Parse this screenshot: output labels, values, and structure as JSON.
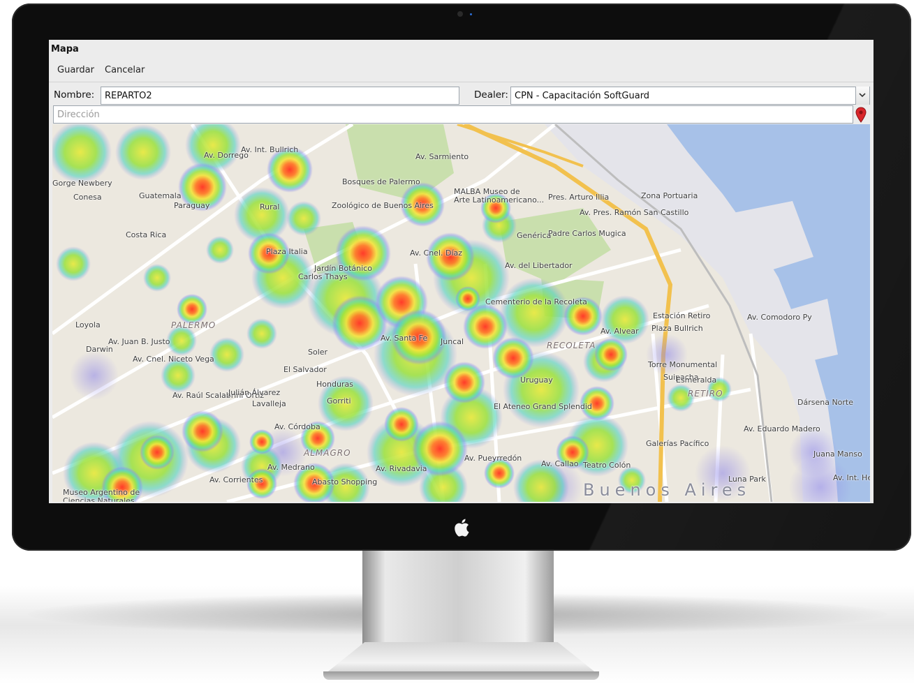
{
  "window": {
    "title": "Mapa"
  },
  "menu": {
    "guardar": "Guardar",
    "cancelar": "Cancelar"
  },
  "form": {
    "nombre_label": "Nombre:",
    "nombre_value": "REPARTO2",
    "dealer_label": "Dealer:",
    "dealer_value": "CPN - Capacitación SoftGuard",
    "direccion_placeholder": "Dirección"
  },
  "icons": {
    "dropdown": "chevron-down-icon",
    "location": "map-pin-icon",
    "brand": "apple-logo"
  },
  "colors": {
    "pin": "#d9262b",
    "water": "#a7c1e8",
    "park": "#c9dfad",
    "heat_hot": "#ff3b2a",
    "heat_mid": "#b9ea3c",
    "heat_low": "#9c8fe6"
  },
  "map": {
    "labels": [
      "Av. Dorrego",
      "Av. Int. Bullrich",
      "Bosques de Palermo",
      "MALBA Museo de",
      "Arte Latinoamericano...",
      "Av. Pres. Ramón San Castillo",
      "Pres. Arturo Illia",
      "Zona Portuaria",
      "Padre Carlos Mugica",
      "Genérica",
      "Av. del Libertador",
      "Cementerio de la Recoleta",
      "Estación Retiro",
      "Plaza Bullrich",
      "Av. Comodoro Py",
      "Torre Monumental",
      "Dársena Norte",
      "RETIRO",
      "RECOLETA",
      "PALERMO",
      "Galerías Pacífico",
      "Teatro Colón",
      "Luna Park",
      "Av. Eduardo Madero",
      "Av. Córdoba",
      "ALMAGRO",
      "Abasto Shopping",
      "Av. Corrientes",
      "Museo Argentino de",
      "Ciencias Naturales",
      "Buenos Aires",
      "Av. Raúl Scalabrini Ortiz",
      "El Salvador",
      "Honduras",
      "Gorriti",
      "Soler",
      "Juncal",
      "Av. Santa Fe",
      "Plaza Italia",
      "Jardín Botánico",
      "Carlos Thays",
      "Costa Rica",
      "Guatemala",
      "Paraguay",
      "Loyola",
      "Darwin",
      "Av. Juan B. Justo",
      "Av. Cnel. Niceto Vega",
      "Lavalleja",
      "Julián Álvarez",
      "Av. Medrano",
      "Av. Rivadavia",
      "Juana Manso",
      "Av. Int. Hernández",
      "Gorge Newbery",
      "Conesa",
      "Suipacha",
      "Esmeralda",
      "Av. Alvear",
      "Rural",
      "Zoológico de Buenos Aires",
      "Av. Pueyrredón",
      "Av. Cnel. Díaz",
      "Av. Callao",
      "El Ateneo Grand Splendid",
      "Uruguay",
      "Av. Sarmiento"
    ]
  }
}
